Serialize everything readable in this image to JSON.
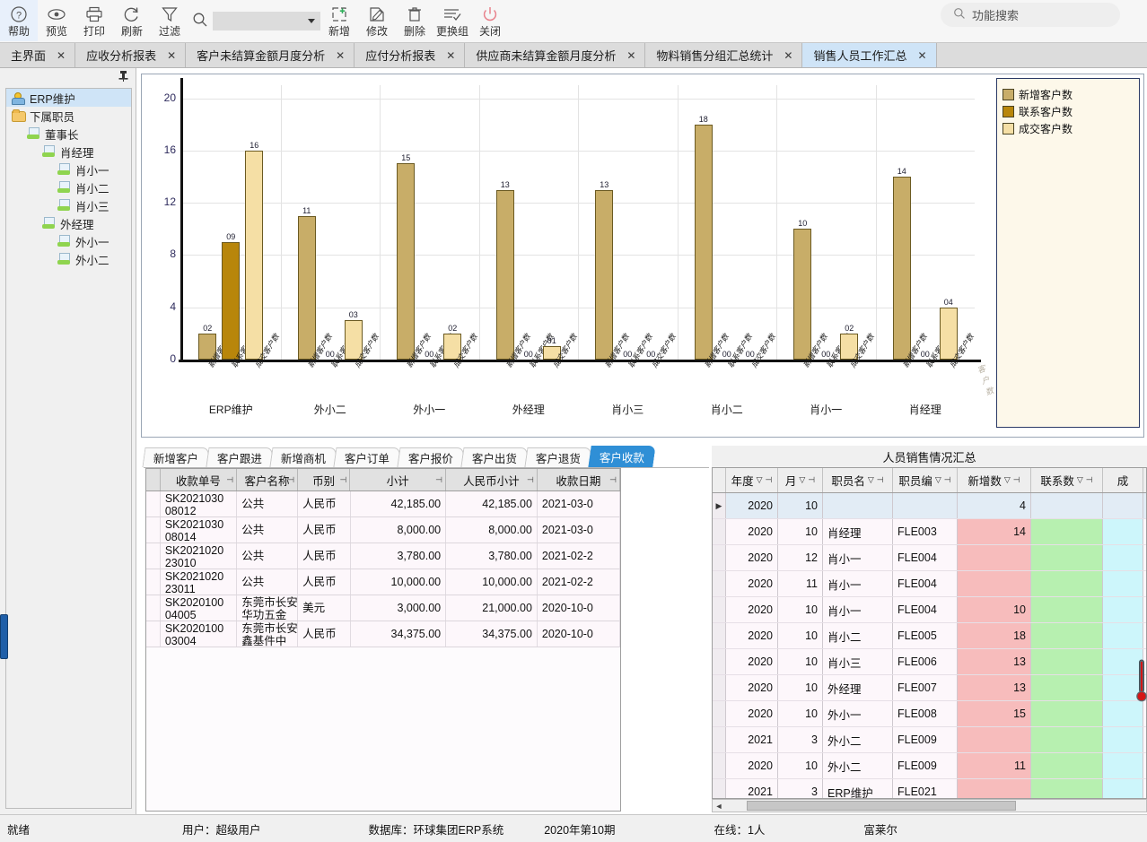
{
  "toolbar": {
    "buttons": [
      {
        "label": "帮助",
        "icon": "help-icon"
      },
      {
        "label": "预览",
        "icon": "preview-eye-icon"
      },
      {
        "label": "打印",
        "icon": "print-icon"
      },
      {
        "label": "刷新",
        "icon": "refresh-icon"
      },
      {
        "label": "过滤",
        "icon": "filter-funnel-icon"
      }
    ],
    "buttons2": [
      {
        "label": "新增",
        "icon": "add-plus-icon"
      },
      {
        "label": "修改",
        "icon": "edit-pencil-icon"
      },
      {
        "label": "删除",
        "icon": "delete-trash-icon"
      },
      {
        "label": "更换组",
        "icon": "switch-group-icon"
      },
      {
        "label": "关闭",
        "icon": "power-close-icon"
      }
    ],
    "search_combo_value": "",
    "func_search_placeholder": "功能搜索"
  },
  "tabs": [
    {
      "label": "主界面",
      "active": false
    },
    {
      "label": "应收分析报表",
      "active": false
    },
    {
      "label": "客户未结算金额月度分析",
      "active": false
    },
    {
      "label": "应付分析报表",
      "active": false
    },
    {
      "label": "供应商未结算金额月度分析",
      "active": false
    },
    {
      "label": "物料销售分组汇总统计",
      "active": false
    },
    {
      "label": "销售人员工作汇总",
      "active": true
    }
  ],
  "tree": {
    "pin": "📌",
    "nodes": [
      {
        "label": "ERP维护",
        "indent": 0,
        "icon": "admin-person-icon",
        "selected": true
      },
      {
        "label": "下属职员",
        "indent": 0,
        "icon": "folder-icon",
        "selected": false
      },
      {
        "label": "董事长",
        "indent": 1,
        "icon": "employee-icon",
        "selected": false
      },
      {
        "label": "肖经理",
        "indent": 2,
        "icon": "employee-icon",
        "selected": false
      },
      {
        "label": "肖小一",
        "indent": 3,
        "icon": "employee-icon",
        "selected": false
      },
      {
        "label": "肖小二",
        "indent": 3,
        "icon": "employee-icon",
        "selected": false
      },
      {
        "label": "肖小三",
        "indent": 3,
        "icon": "employee-icon",
        "selected": false
      },
      {
        "label": "外经理",
        "indent": 2,
        "icon": "employee-icon",
        "selected": false
      },
      {
        "label": "外小一",
        "indent": 3,
        "icon": "employee-icon",
        "selected": false
      },
      {
        "label": "外小二",
        "indent": 3,
        "icon": "employee-icon",
        "selected": false
      }
    ]
  },
  "chart_data": {
    "type": "bar",
    "title": "",
    "xlabel": "",
    "ylabel": "",
    "ylim": [
      0,
      21
    ],
    "yticks": [
      0,
      4,
      8,
      12,
      16,
      20
    ],
    "grid": true,
    "legend_position": "right",
    "categories": [
      "ERP维护",
      "外小二",
      "外小一",
      "外经理",
      "肖小三",
      "肖小二",
      "肖小一",
      "肖经理"
    ],
    "series": [
      {
        "name": "新增客户数",
        "color": "#c8ad68",
        "values": [
          2,
          11,
          15,
          13,
          13,
          18,
          10,
          14
        ],
        "labels": [
          "02",
          "11",
          "15",
          "13",
          "13",
          "18",
          "10",
          "14"
        ]
      },
      {
        "name": "联系客户数",
        "color": "#b8860b",
        "values": [
          9,
          0,
          0,
          0,
          0,
          0,
          0,
          0
        ],
        "labels": [
          "09",
          "00",
          "00",
          "00",
          "00",
          "00",
          "00",
          "00"
        ]
      },
      {
        "name": "成交客户数",
        "color": "#f5dfa5",
        "values": [
          16,
          3,
          2,
          1,
          0,
          0,
          2,
          4
        ],
        "labels": [
          "16",
          "03",
          "02",
          "01",
          "00",
          "00",
          "02",
          "04"
        ]
      }
    ],
    "axis_tick_label": "客户数"
  },
  "bottom_left": {
    "tabs": [
      {
        "label": "新增客户",
        "active": false
      },
      {
        "label": "客户跟进",
        "active": false
      },
      {
        "label": "新增商机",
        "active": false
      },
      {
        "label": "客户订单",
        "active": false
      },
      {
        "label": "客户报价",
        "active": false
      },
      {
        "label": "客户出货",
        "active": false
      },
      {
        "label": "客户退货",
        "active": false
      },
      {
        "label": "客户收款",
        "active": true
      }
    ],
    "columns": [
      "收款单号",
      "客户名称",
      "币别",
      "小计",
      "人民币小计",
      "收款日期"
    ],
    "rows": [
      {
        "no": "SK2021030",
        "no2": "08012",
        "name": "公共",
        "name2": "",
        "cur": "人民币",
        "sub": "42,185.00",
        "rmb": "42,185.00",
        "date": "2021-03-0"
      },
      {
        "no": "SK2021030",
        "no2": "08014",
        "name": "公共",
        "name2": "",
        "cur": "人民币",
        "sub": "8,000.00",
        "rmb": "8,000.00",
        "date": "2021-03-0"
      },
      {
        "no": "SK2021020",
        "no2": "23010",
        "name": "公共",
        "name2": "",
        "cur": "人民币",
        "sub": "3,780.00",
        "rmb": "3,780.00",
        "date": "2021-02-2"
      },
      {
        "no": "SK2021020",
        "no2": "23011",
        "name": "公共",
        "name2": "",
        "cur": "人民币",
        "sub": "10,000.00",
        "rmb": "10,000.00",
        "date": "2021-02-2"
      },
      {
        "no": "SK2020100",
        "no2": "04005",
        "name": "东莞市长安",
        "name2": "华功五金",
        "cur": "美元",
        "sub": "3,000.00",
        "rmb": "21,000.00",
        "date": "2020-10-0"
      },
      {
        "no": "SK2020100",
        "no2": "03004",
        "name": "东莞市长安",
        "name2": "鑫基件中",
        "cur": "人民币",
        "sub": "34,375.00",
        "rmb": "34,375.00",
        "date": "2020-10-0"
      }
    ]
  },
  "bottom_right": {
    "title": "人员销售情况汇总",
    "columns": [
      "年度",
      "月",
      "职员名",
      "职员编",
      "新增数",
      "联系数",
      "成"
    ],
    "rows": [
      {
        "marker": "▶",
        "year": "2020",
        "month": "10",
        "name": "",
        "code": "",
        "add": "4",
        "contact": "",
        "deal": ""
      },
      {
        "marker": "",
        "year": "2020",
        "month": "10",
        "name": "肖经理",
        "code": "FLE003",
        "add": "14",
        "contact": "",
        "deal": ""
      },
      {
        "marker": "",
        "year": "2020",
        "month": "12",
        "name": "肖小一",
        "code": "FLE004",
        "add": "",
        "contact": "",
        "deal": ""
      },
      {
        "marker": "",
        "year": "2020",
        "month": "11",
        "name": "肖小一",
        "code": "FLE004",
        "add": "",
        "contact": "",
        "deal": ""
      },
      {
        "marker": "",
        "year": "2020",
        "month": "10",
        "name": "肖小一",
        "code": "FLE004",
        "add": "10",
        "contact": "",
        "deal": ""
      },
      {
        "marker": "",
        "year": "2020",
        "month": "10",
        "name": "肖小二",
        "code": "FLE005",
        "add": "18",
        "contact": "",
        "deal": ""
      },
      {
        "marker": "",
        "year": "2020",
        "month": "10",
        "name": "肖小三",
        "code": "FLE006",
        "add": "13",
        "contact": "",
        "deal": ""
      },
      {
        "marker": "",
        "year": "2020",
        "month": "10",
        "name": "外经理",
        "code": "FLE007",
        "add": "13",
        "contact": "",
        "deal": ""
      },
      {
        "marker": "",
        "year": "2020",
        "month": "10",
        "name": "外小一",
        "code": "FLE008",
        "add": "15",
        "contact": "",
        "deal": ""
      },
      {
        "marker": "",
        "year": "2021",
        "month": "3",
        "name": "外小二",
        "code": "FLE009",
        "add": "",
        "contact": "",
        "deal": ""
      },
      {
        "marker": "",
        "year": "2020",
        "month": "10",
        "name": "外小二",
        "code": "FLE009",
        "add": "11",
        "contact": "",
        "deal": ""
      },
      {
        "marker": "",
        "year": "2021",
        "month": "3",
        "name": "ERP维护",
        "code": "FLE021",
        "add": "",
        "contact": "",
        "deal": ""
      }
    ]
  },
  "statusbar": {
    "ready": "就绪",
    "user": "用户：超级用户",
    "database": "数据库：环球集团ERP系统",
    "period": "2020年第10期",
    "online": "在线：1人",
    "company": "富莱尔"
  }
}
